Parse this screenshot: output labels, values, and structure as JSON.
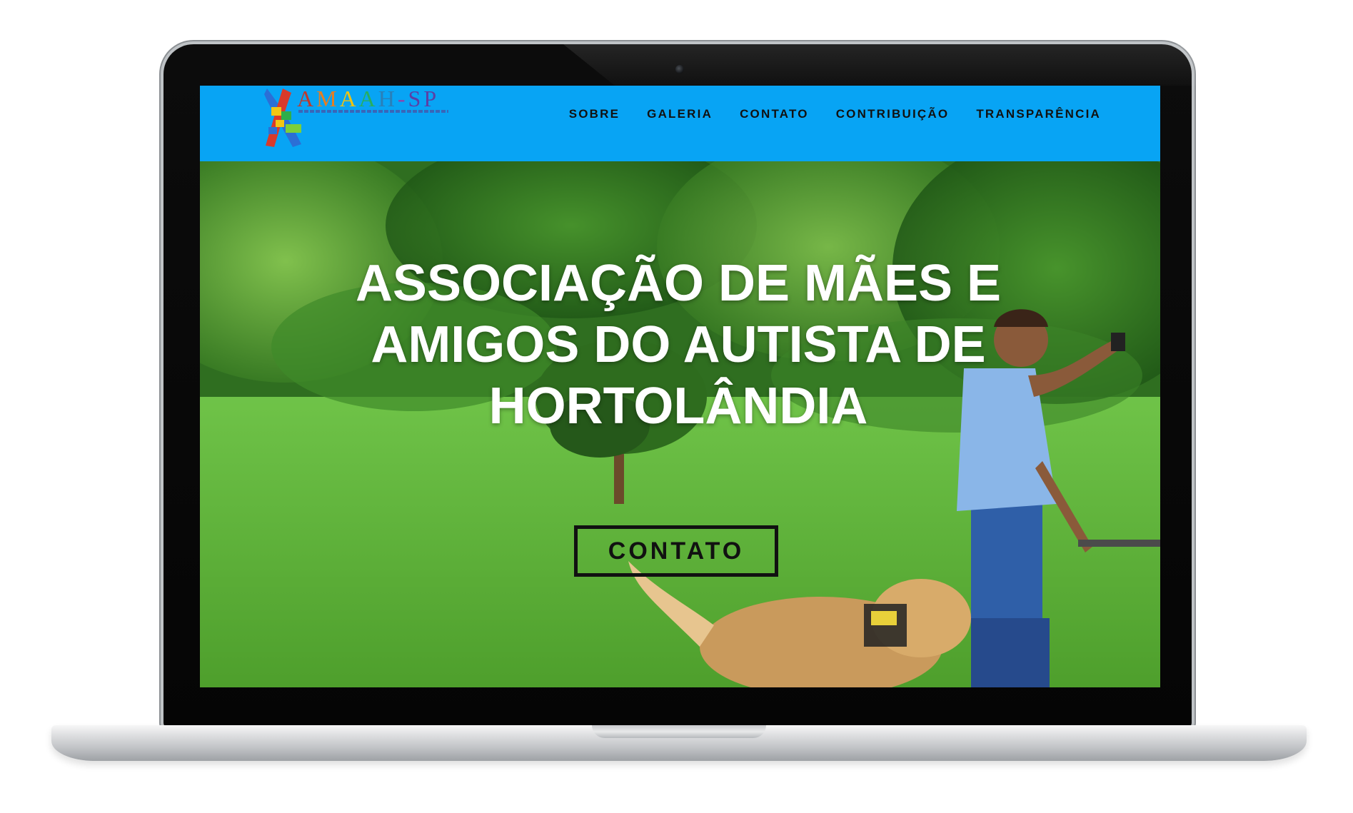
{
  "site": {
    "logo": {
      "letters": [
        {
          "char": "A",
          "color": "#c0392b"
        },
        {
          "char": "M",
          "color": "#e67e22"
        },
        {
          "char": "A",
          "color": "#f1c40f"
        },
        {
          "char": "A",
          "color": "#27ae60"
        },
        {
          "char": "H",
          "color": "#2980b9"
        },
        {
          "char": "-",
          "color": "#8e44ad"
        },
        {
          "char": "S",
          "color": "#5b3fa6"
        },
        {
          "char": "P",
          "color": "#5b3fa6"
        }
      ],
      "ribbon_icon": "autism-puzzle-ribbon-icon"
    },
    "nav": {
      "items": [
        "SOBRE",
        "GALERIA",
        "CONTATO",
        "CONTRIBUIÇÃO",
        "TRANSPARÊNCIA"
      ]
    },
    "hero": {
      "title_lines": [
        "ASSOCIAÇÃO DE MÃES E",
        "AMIGOS DO AUTISTA DE",
        "HORTOLÂNDIA"
      ],
      "cta_label": "CONTATO"
    },
    "colors": {
      "navbar": "#08a4f4",
      "nav_text": "#111111",
      "hero_text": "#ffffff"
    }
  }
}
